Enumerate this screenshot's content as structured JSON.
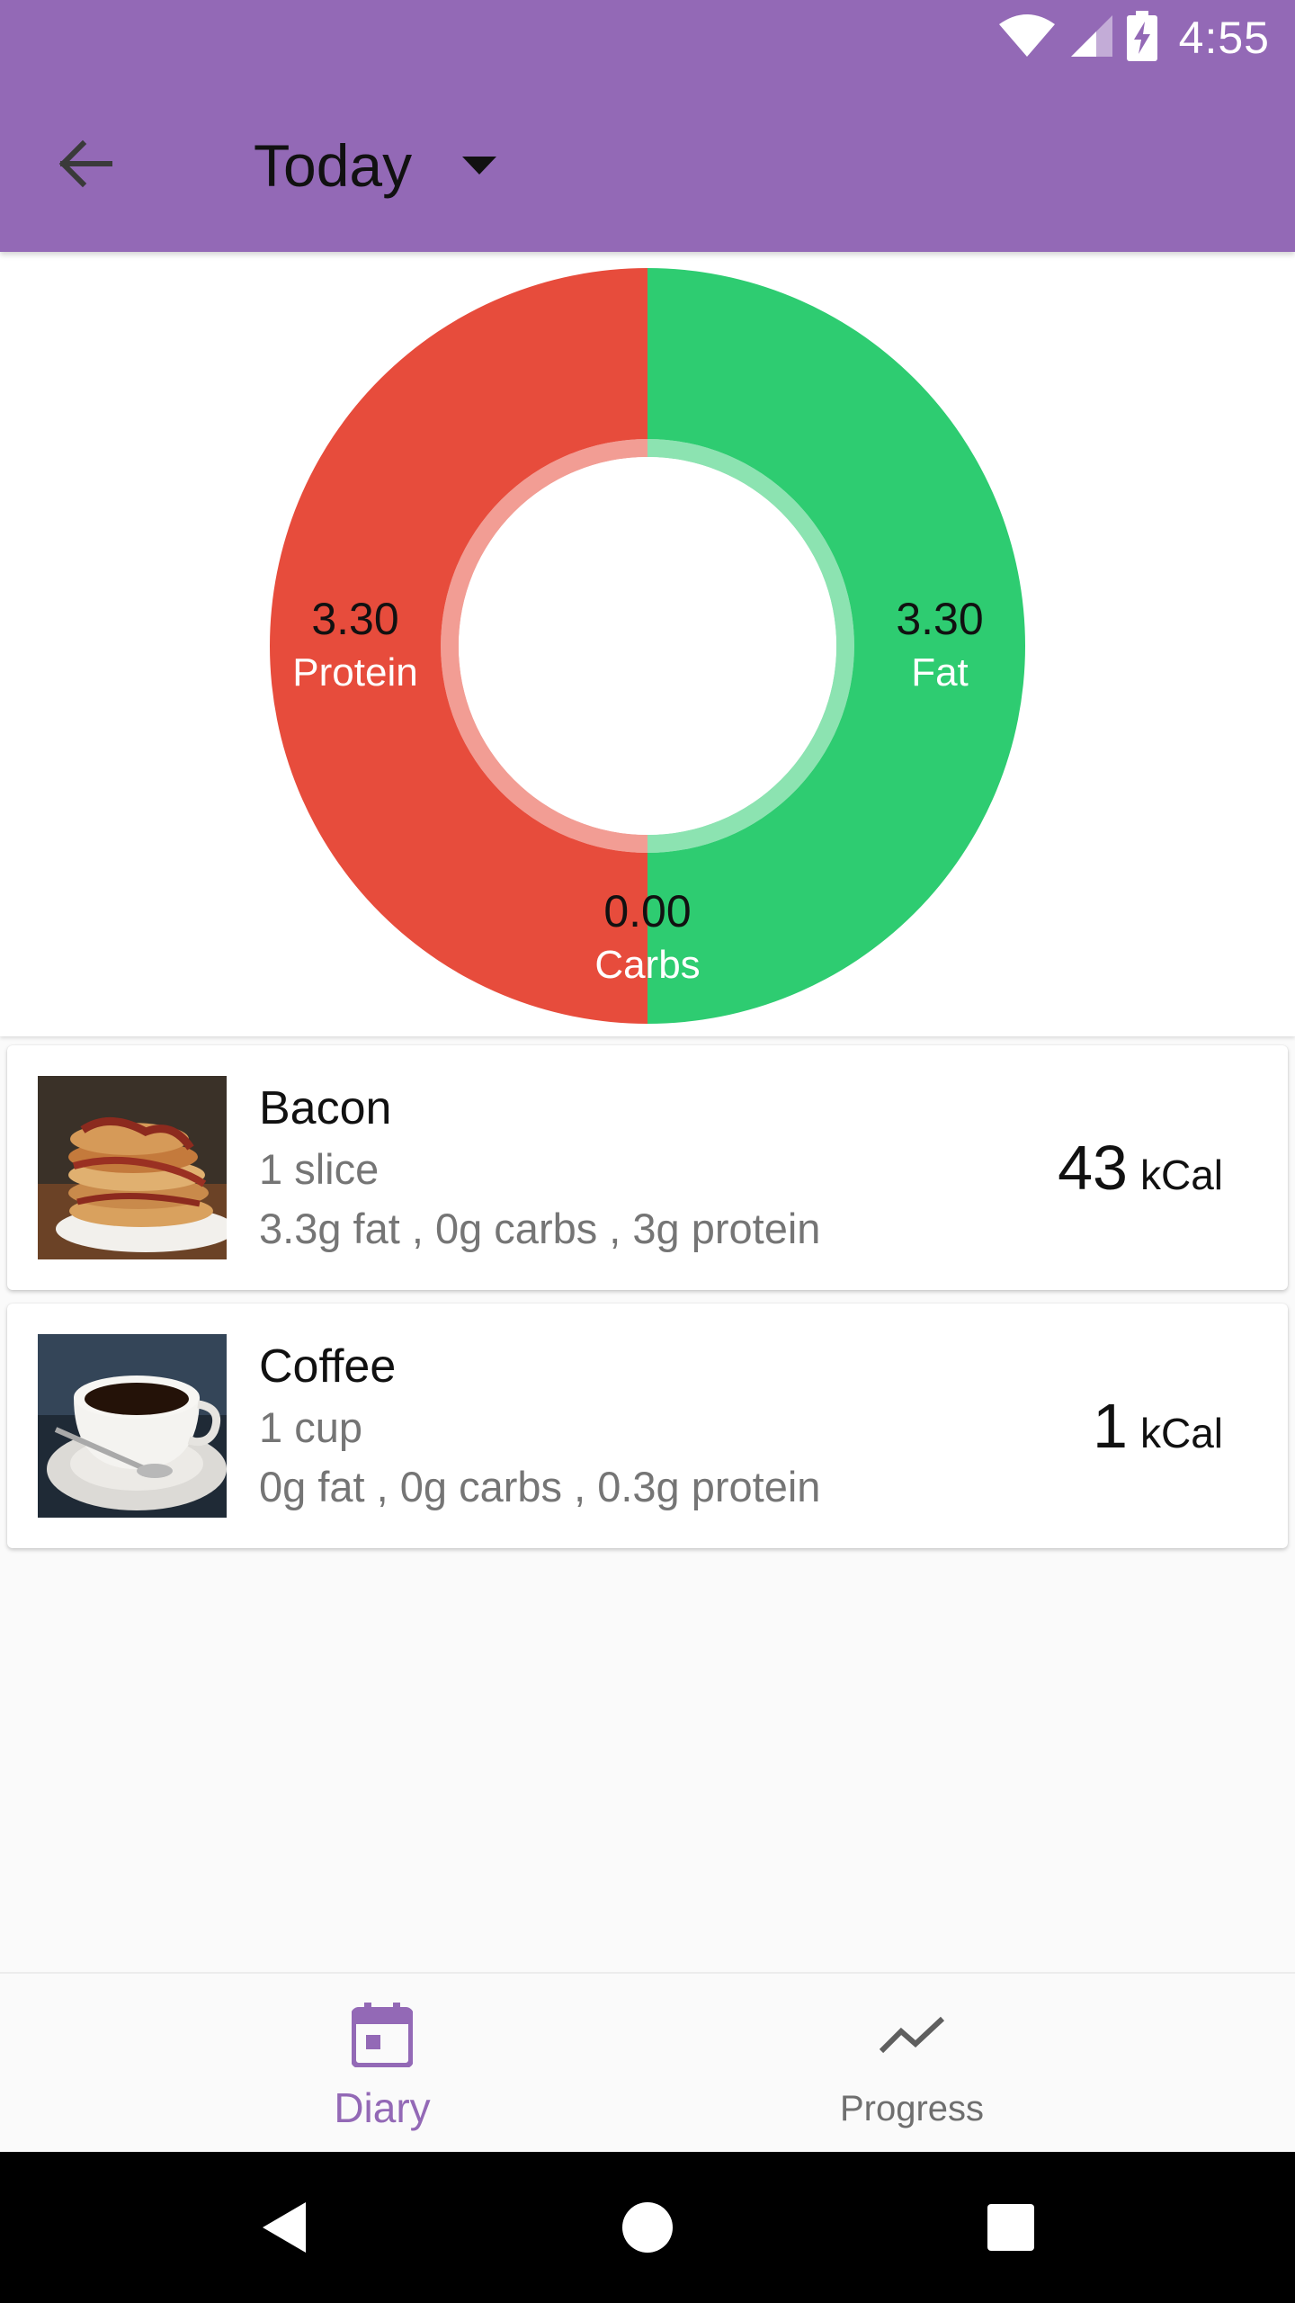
{
  "status_bar": {
    "time": "4:55",
    "icons": [
      "wifi-icon",
      "cellular-signal-icon",
      "battery-charging-icon"
    ]
  },
  "toolbar": {
    "back_icon": "arrow-back-icon",
    "date_label": "Today",
    "dropdown_icon": "caret-down-icon"
  },
  "colors": {
    "primary": "#9369b6",
    "protein": "#e74c3c",
    "fat": "#2ecc71",
    "carbs": "#3498db"
  },
  "chart_data": {
    "type": "pie",
    "donut": true,
    "slices": [
      {
        "name": "Fat",
        "value": 3.3,
        "label": "3.30",
        "color": "#2ecc71"
      },
      {
        "name": "Carbs",
        "value": 0.0,
        "label": "0.00",
        "color": "#3498db"
      },
      {
        "name": "Protein",
        "value": 3.3,
        "label": "3.30",
        "color": "#e74c3c"
      }
    ]
  },
  "foods": [
    {
      "name": "Bacon",
      "serving": "1 slice",
      "macros": "3.3g fat , 0g carbs , 3g protein",
      "kcal_value": "43",
      "kcal_unit": "kCal",
      "image": "bacon-pancakes-photo"
    },
    {
      "name": "Coffee",
      "serving": "1 cup",
      "macros": "0g fat , 0g carbs , 0.3g protein",
      "kcal_value": "1",
      "kcal_unit": "kCal",
      "image": "coffee-cup-photo"
    }
  ],
  "bottom_nav": {
    "items": [
      {
        "label": "Diary",
        "icon": "calendar-icon",
        "active": true
      },
      {
        "label": "Progress",
        "icon": "trending-up-icon",
        "active": false
      }
    ]
  },
  "system_nav": {
    "icons": [
      "back-triangle-icon",
      "home-circle-icon",
      "recents-square-icon"
    ]
  }
}
